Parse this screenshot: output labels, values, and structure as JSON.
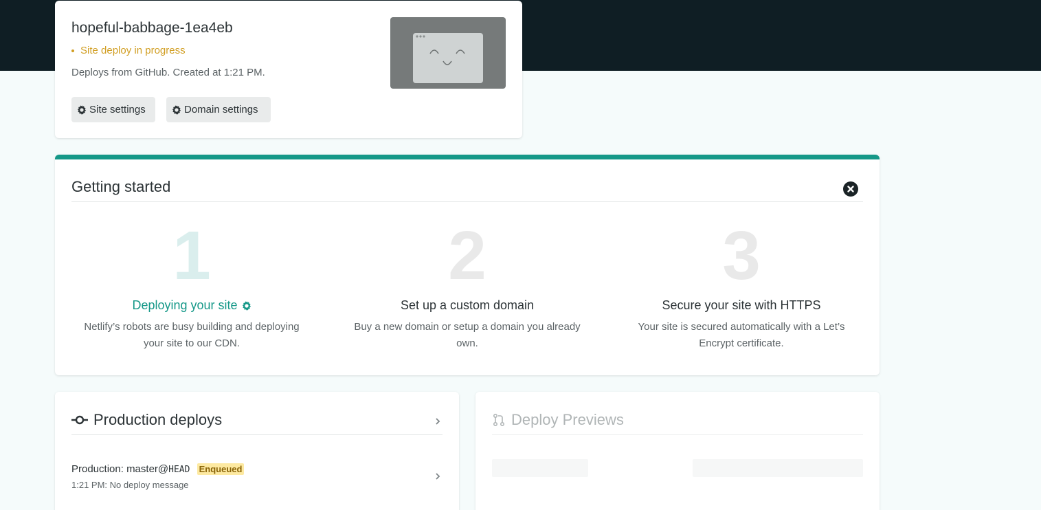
{
  "site": {
    "name": "hopeful-babbage-1ea4eb",
    "status": "Site deploy in progress",
    "meta": "Deploys from GitHub. Created at 1:21 PM.",
    "buttons": {
      "site_settings": "Site settings",
      "domain_settings": "Domain settings"
    },
    "status_color": "#d19e22"
  },
  "getting_started": {
    "title": "Getting started",
    "accent_color": "#159888",
    "steps": [
      {
        "number": "1",
        "title": "Deploying your site",
        "description": "Netlify’s robots are busy building and deploying your site to our CDN.",
        "icon": "gear-icon"
      },
      {
        "number": "2",
        "title": "Set up a custom domain",
        "description": "Buy a new domain or setup a domain you already own."
      },
      {
        "number": "3",
        "title": "Secure your site with HTTPS",
        "description": "Your site is secured automatically with a Let’s Encrypt certificate."
      }
    ]
  },
  "production": {
    "title": "Production deploys",
    "row": {
      "label": "Production:",
      "branch": "master@",
      "ref": "HEAD",
      "badge": "Enqueued",
      "sub": "1:21 PM: No deploy message"
    }
  },
  "previews": {
    "title": "Deploy Previews"
  }
}
